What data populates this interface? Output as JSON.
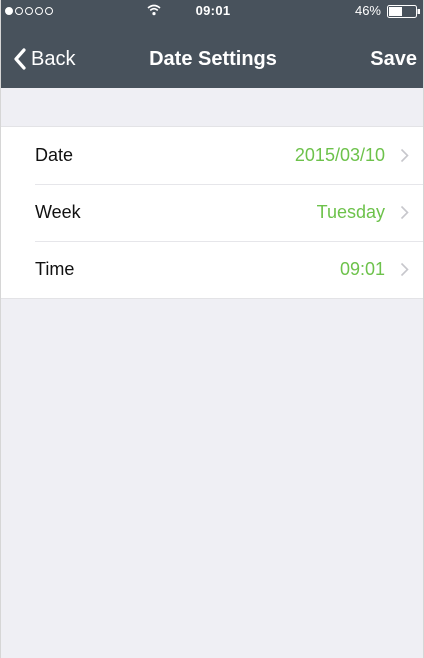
{
  "status_bar": {
    "time": "09:01",
    "battery": "46%",
    "signal_dots_filled": 1,
    "signal_dots_total": 5
  },
  "nav": {
    "back_label": "Back",
    "title": "Date Settings",
    "save_label": "Save"
  },
  "settings": {
    "rows": [
      {
        "label": "Date",
        "value": "2015/03/10"
      },
      {
        "label": "Week",
        "value": "Tuesday"
      },
      {
        "label": "Time",
        "value": "09:01"
      }
    ]
  },
  "colors": {
    "nav_background": "#48525c",
    "value_accent": "#6dc24b",
    "page_background": "#efeff4"
  }
}
